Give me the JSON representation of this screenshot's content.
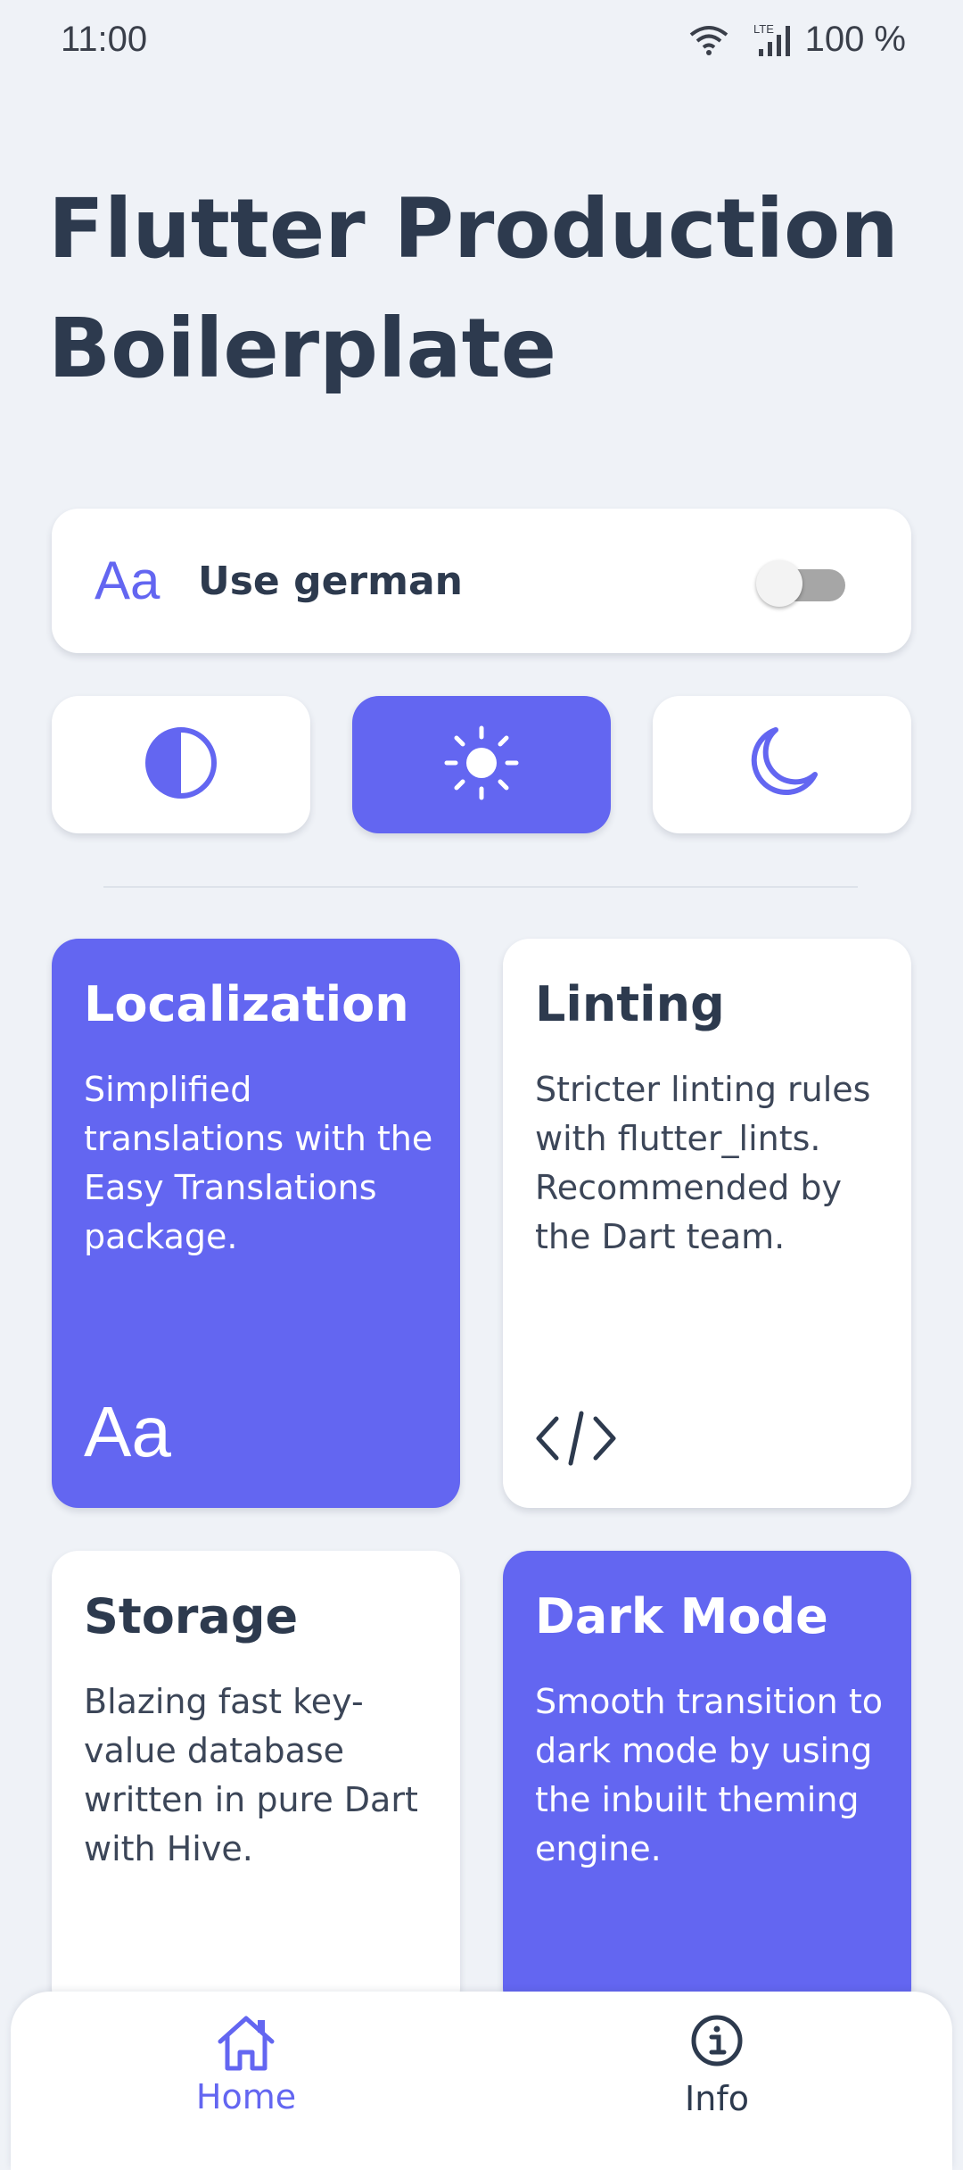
{
  "status_bar": {
    "time": "11:00",
    "battery": "100 %",
    "network": "LTE"
  },
  "page": {
    "title": "Flutter Production Boilerplate"
  },
  "language_setting": {
    "icon_text": "Aa",
    "label": "Use german",
    "enabled": false
  },
  "theme_selector": {
    "options": [
      {
        "name": "system",
        "icon": "contrast-icon",
        "selected": false
      },
      {
        "name": "light",
        "icon": "sun-icon",
        "selected": true
      },
      {
        "name": "dark",
        "icon": "moon-icon",
        "selected": false
      }
    ]
  },
  "features": [
    {
      "title": "Localization",
      "description": "Simplified translations with the Easy Translations package.",
      "icon_text": "Aa",
      "style": "purple"
    },
    {
      "title": "Linting",
      "description": "Stricter linting rules with flutter_lints. Recommended by the Dart team.",
      "icon": "code-icon",
      "style": "white"
    },
    {
      "title": "Storage",
      "description": "Blazing fast key-value database written in pure Dart with Hive.",
      "style": "white"
    },
    {
      "title": "Dark Mode",
      "description": "Smooth transition to dark mode by using the inbuilt theming engine.",
      "style": "purple"
    }
  ],
  "bottom_nav": {
    "items": [
      {
        "label": "Home",
        "icon": "home-icon",
        "active": true
      },
      {
        "label": "Info",
        "icon": "info-icon",
        "active": false
      }
    ]
  },
  "colors": {
    "accent": "#6366f1",
    "background": "#eff2f7",
    "text": "#2d3a4e",
    "card": "#ffffff"
  }
}
